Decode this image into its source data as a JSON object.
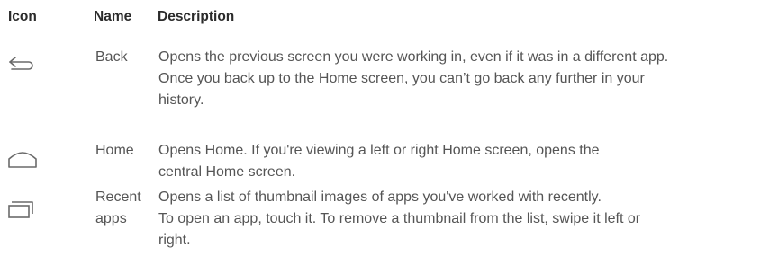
{
  "headers": {
    "icon": "Icon",
    "name": "Name",
    "description": "Description"
  },
  "rows": [
    {
      "icon": "back-arrow-icon",
      "name": "Back",
      "lines": [
        "Opens the previous screen you were working in, even if it was in a different app.",
        "Once you back up to the Home screen, you can’t go back any further in your",
        "history."
      ]
    },
    {
      "icon": "home-icon",
      "name": "Home",
      "lines": [
        "Opens Home. If you're viewing a left or right Home screen, opens the",
        "central Home screen."
      ]
    },
    {
      "icon": "recent-apps-icon",
      "name_lines": [
        "Recent",
        "apps"
      ],
      "lines": [
        "Opens a list of thumbnail images of apps you've worked with recently.",
        "To open an app, touch it. To remove a thumbnail from the list, swipe it left or",
        "right."
      ]
    }
  ]
}
